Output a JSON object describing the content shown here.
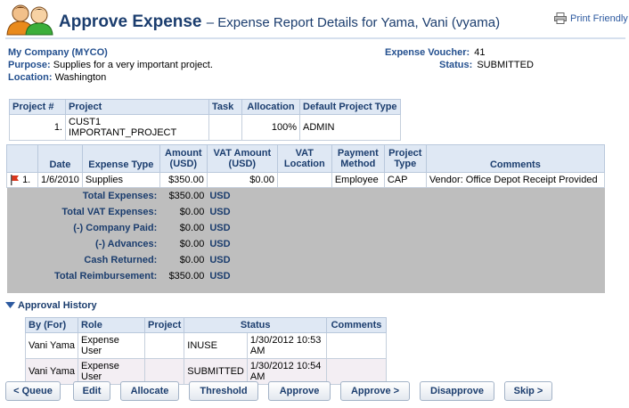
{
  "header": {
    "title": "Approve Expense",
    "subtitle": "– Expense Report Details for Yama, Vani (vyama)",
    "print_label": "Print Friendly"
  },
  "info": {
    "company": "My Company (MYCO)",
    "purpose_label": "Purpose:",
    "purpose_value": "Supplies for a very important project.",
    "location_label": "Location:",
    "location_value": "Washington",
    "voucher_label": "Expense Voucher:",
    "voucher_value": "41",
    "status_label": "Status:",
    "status_value": "SUBMITTED"
  },
  "project_table": {
    "headers": [
      "Project #",
      "Project",
      "Task",
      "Allocation",
      "Default Project Type"
    ],
    "rows": [
      [
        "1.",
        "CUST1 IMPORTANT_PROJECT",
        "",
        "100%",
        "ADMIN"
      ]
    ]
  },
  "expense_table": {
    "headers": [
      "",
      "Date",
      "Expense Type",
      "Amount (USD)",
      "VAT Amount (USD)",
      "VAT Location",
      "Payment Method",
      "Project Type",
      "Comments"
    ],
    "rows": [
      {
        "num": "1.",
        "date": "1/6/2010",
        "type": "Supplies",
        "amount": "$350.00",
        "vat": "$0.00",
        "vat_location": "",
        "payment": "Employee",
        "project_type": "CAP",
        "comments": "Vendor: Office Depot Receipt Provided"
      }
    ],
    "totals": [
      {
        "label": "Total Expenses:",
        "value": "$350.00",
        "currency": "USD"
      },
      {
        "label": "Total VAT Expenses:",
        "value": "$0.00",
        "currency": "USD"
      },
      {
        "label": "(-) Company Paid:",
        "value": "$0.00",
        "currency": "USD"
      },
      {
        "label": "(-) Advances:",
        "value": "$0.00",
        "currency": "USD"
      },
      {
        "label": "Cash Returned:",
        "value": "$0.00",
        "currency": "USD"
      },
      {
        "label": "Total Reimbursement:",
        "value": "$350.00",
        "currency": "USD"
      }
    ]
  },
  "approval": {
    "title": "Approval History",
    "headers": [
      "By (For)",
      "Role",
      "Project",
      "Status",
      "",
      "Comments"
    ],
    "rows": [
      [
        "Vani Yama",
        "Expense User",
        "",
        "INUSE",
        "1/30/2012 10:53 AM",
        ""
      ],
      [
        "Vani Yama",
        "Expense User",
        "",
        "SUBMITTED",
        "1/30/2012 10:54 AM",
        ""
      ]
    ]
  },
  "buttons": {
    "queue": "< Queue",
    "edit": "Edit",
    "allocate": "Allocate",
    "threshold": "Threshold",
    "approve": "Approve",
    "approve_next": "Approve >",
    "disapprove": "Disapprove",
    "skip": "Skip >"
  },
  "colors": {
    "title": "#1b3d6e",
    "label": "#24508f",
    "header_bg": "#dfe8f4",
    "totals_bg": "#bebebe",
    "flag": "#d9361c"
  }
}
